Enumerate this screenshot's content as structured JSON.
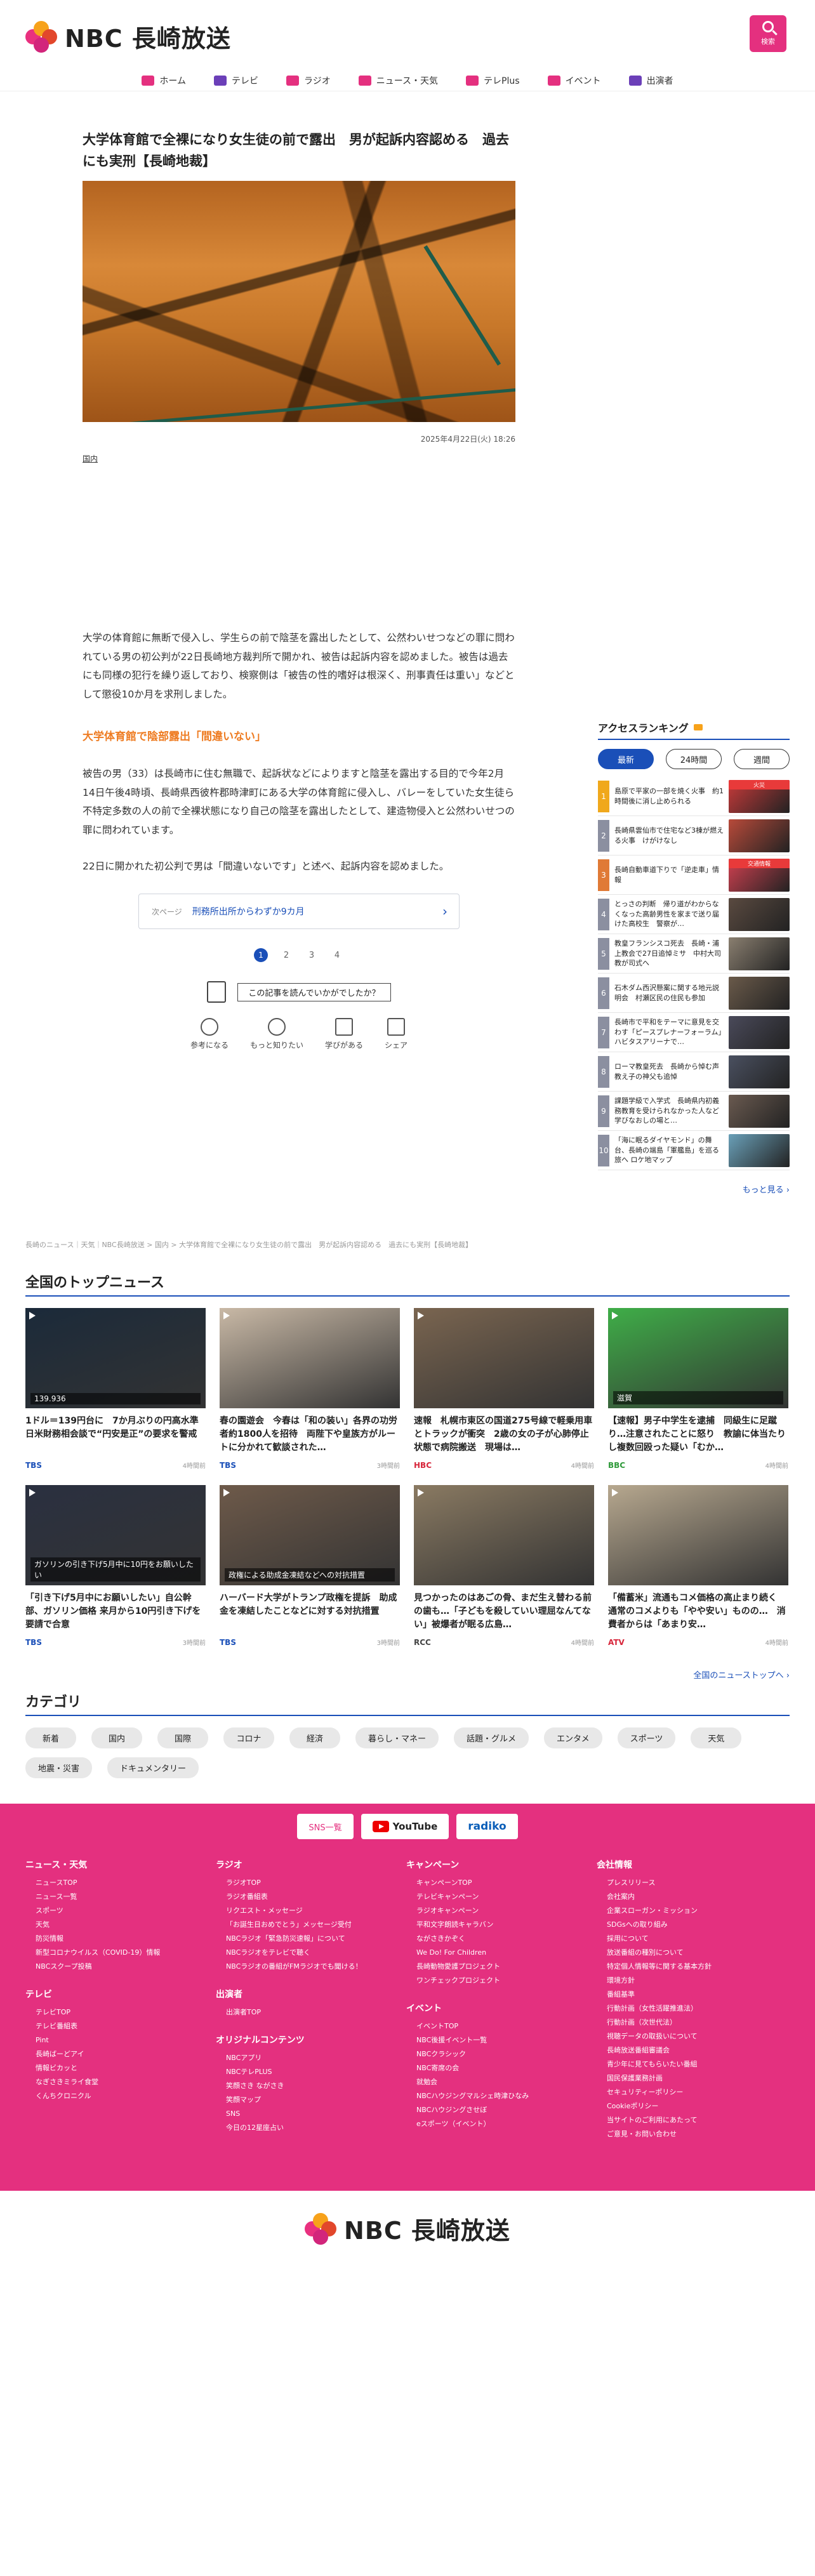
{
  "header": {
    "logo_text": "NBC 長崎放送",
    "search_label": "検索"
  },
  "nav": [
    {
      "label": "ホーム",
      "icon": "home-icon",
      "color": "#e4307f"
    },
    {
      "label": "テレビ",
      "icon": "tv-icon",
      "color": "#6b3fb8"
    },
    {
      "label": "ラジオ",
      "icon": "radio-icon",
      "color": "#e4307f"
    },
    {
      "label": "ニュース・天気",
      "icon": "news-icon",
      "color": "#e4307f"
    },
    {
      "label": "テレPlus",
      "icon": "play-icon",
      "color": "#e4307f"
    },
    {
      "label": "イベント",
      "icon": "calendar-icon",
      "color": "#e4307f"
    },
    {
      "label": "出演者",
      "icon": "people-icon",
      "color": "#6b3fb8"
    }
  ],
  "article": {
    "title": "大学体育館で全裸になり女生徒の前で露出　男が起訴内容認める　過去にも実刑【長崎地裁】",
    "date": "2025年4月22日(火) 18:26",
    "genre": "国内",
    "para1": "大学の体育館に無断で侵入し、学生らの前で陰茎を露出したとして、公然わいせつなどの罪に問われている男の初公判が22日長崎地方裁判所で開かれ、被告は起訴内容を認めました。被告は過去にも同様の犯行を繰り返しており、検察側は「被告の性的嗜好は根深く、刑事責任は重い」などとして懲役10か月を求刑しました。",
    "subhead": "大学体育館で陰部露出「間違いない」",
    "para2": "被告の男（33）は長崎市に住む無職で、起訴状などによりますと陰茎を露出する目的で今年2月14日午後4時頃、長崎県西彼杵郡時津町にある大学の体育館に侵入し、バレーをしていた女生徒ら不特定多数の人の前で全裸状態になり自己の陰茎を露出したとして、建造物侵入と公然わいせつの罪に問われています。",
    "para3": "22日に開かれた初公判で男は「間違いないです」と述べ、起訴内容を認めました。",
    "next_label": "次ページ",
    "next_title": "刑務所出所からわずか9カ月",
    "pages": [
      "1",
      "2",
      "3",
      "4"
    ],
    "feedback_question": "この記事を読んでいかがでしたか？",
    "reactions": [
      "参考になる",
      "もっと知りたい",
      "学びがある",
      "シェア"
    ]
  },
  "ranking": {
    "title": "アクセスランキング",
    "tabs": [
      "最新",
      "24時間",
      "週間"
    ],
    "items": [
      {
        "num": "1",
        "text": "島原で平家の一部を焼く火事　約1時間後に消し止められる",
        "color": "#f0a81c",
        "badge": "火災"
      },
      {
        "num": "2",
        "text": "長崎県雲仙市で住宅など3棟が燃える火事　けがけなし",
        "color": "#8b8fa0",
        "badge": ""
      },
      {
        "num": "3",
        "text": "長崎自動車道下りで「逆走車」情報",
        "color": "#e07a36",
        "badge": "交通情報"
      },
      {
        "num": "4",
        "text": "とっさの判断　帰り道がわからなくなった高齢男性を家まで送り届けた高校生　警察が…",
        "color": "#8b8fa0",
        "badge": ""
      },
      {
        "num": "5",
        "text": "教皇フランシスコ死去　長崎・浦上教会で27日追悼ミサ　中村大司教が司式へ",
        "color": "#8b8fa0",
        "badge": ""
      },
      {
        "num": "6",
        "text": "石木ダム西沢懸案に関する地元説明会　村瀬区民の住民も参加",
        "color": "#8b8fa0",
        "badge": ""
      },
      {
        "num": "7",
        "text": "長崎市で平和をテーマに意見を交わす「ピースプレナーフォーラム」ハビタスアリーナで…",
        "color": "#8b8fa0",
        "badge": ""
      },
      {
        "num": "8",
        "text": "ローマ教皇死去　長崎から悼む声　教え子の神父も追悼",
        "color": "#8b8fa0",
        "badge": ""
      },
      {
        "num": "9",
        "text": "課題学級で入学式　長崎県内初義務教育を受けられなかった人など学びなおしの場と…",
        "color": "#8b8fa0",
        "badge": ""
      },
      {
        "num": "10",
        "text": "「海に眠るダイヤモンド」の舞台、長崎の端島「軍艦島」を巡る旅へ ロケ地マップ",
        "color": "#8b8fa0",
        "badge": ""
      }
    ],
    "more": "もっと見る ›"
  },
  "breadcrumb": "長崎のニュース｜天気｜NBC長崎放送 > 国内 > 大学体育館で全裸になり女生徒の前で露出　男が起訴内容認める　過去にも実刑【長崎地裁】",
  "top_news": {
    "title": "全国のトップニュース",
    "items": [
      {
        "title": "1ドル＝139円台に　7か月ぶりの円高水準　日米財務相会談で“円安是正”の要求を警戒",
        "src": "TBS",
        "time": "4時間前",
        "cap": "139.936",
        "color": "#1b2a3a",
        "srccolor": "#1a4fb8"
      },
      {
        "title": "春の園遊会　今春は「和の装い」各界の功労者約1800人を招待　両陛下や皇族方がルートに分かれて歓談された…",
        "src": "TBS",
        "time": "3時間前",
        "cap": "",
        "color": "#c9b9a6",
        "srccolor": "#1a4fb8"
      },
      {
        "title": "速報　札幌市東区の国道275号線で軽乗用車とトラックが衝突　2歳の女の子が心肺停止状態で病院搬送　現場は…",
        "src": "HBC",
        "time": "4時間前",
        "cap": "",
        "color": "#7a6550",
        "srccolor": "#d7253a"
      },
      {
        "title": "【速報】男子中学生を逮捕　同級生に足蹴り…注意されたことに怒り　教諭に体当たりし複数回殴った疑い「むか…",
        "src": "BBC",
        "time": "4時間前",
        "cap": "滋賀",
        "color": "#3fae48",
        "srccolor": "#2f9a3a"
      },
      {
        "title": "「引き下げ5月中にお願いしたい」自公幹部、ガソリン価格 来月から10円引き下げを要請で合意",
        "src": "TBS",
        "time": "3時間前",
        "cap": "ガソリンの引き下げ5月中に10円をお願いしたい",
        "color": "#2a3040",
        "srccolor": "#1a4fb8"
      },
      {
        "title": "ハーバード大学がトランプ政権を提訴　助成金を凍結したことなどに対する対抗措置",
        "src": "TBS",
        "time": "3時間前",
        "cap": "政権による助成金凍結などへの対抗措置",
        "color": "#6e5a4a",
        "srccolor": "#1a4fb8"
      },
      {
        "title": "見つかったのはあごの骨、まだ生え替わる前の歯も…「子どもを殺していい理屈なんてない」被爆者が眠る広島…",
        "src": "RCC",
        "time": "4時間前",
        "cap": "",
        "color": "#8a7a62",
        "srccolor": "#444444"
      },
      {
        "title": "「備蓄米」流通もコメ価格の高止まり続く　通常のコメよりも「やや安い」ものの…　消費者からは「あまり安…",
        "src": "ATV",
        "time": "4時間前",
        "cap": "",
        "color": "#b7a88f",
        "srccolor": "#d7253a"
      }
    ],
    "all_link": "全国のニューストップへ ›"
  },
  "categories": {
    "title": "カテゴリ",
    "items": [
      "新着",
      "国内",
      "国際",
      "コロナ",
      "経済",
      "暮らし・マネー",
      "話題・グルメ",
      "エンタメ",
      "スポーツ",
      "天気",
      "地震・災害",
      "ドキュメンタリー"
    ]
  },
  "footer": {
    "buttons": [
      "SNS一覧",
      "YouTube",
      "radiko"
    ],
    "cols": [
      [
        {
          "title": "ニュース・天気",
          "items": [
            "ニュースTOP",
            "ニュース一覧",
            "スポーツ",
            "天気",
            "防災情報",
            "新型コロナウイルス（COVID-19）情報",
            "NBCスクープ投稿"
          ]
        },
        {
          "title": "テレビ",
          "items": [
            "テレビTOP",
            "テレビ番組表",
            "Pint",
            "長崎ばーどアイ",
            "情報ビカッと",
            "なぎさきミライ食堂",
            "くんちクロニクル"
          ]
        }
      ],
      [
        {
          "title": "ラジオ",
          "items": [
            "ラジオTOP",
            "ラジオ番組表",
            "リクエスト・メッセージ",
            "「お誕生日おめでとう」メッセージ受付",
            "NBCラジオ「緊急防災速報」について",
            "NBCラジオをテレビで聴く",
            "NBCラジオの番組がFMラジオでも聞ける！"
          ]
        },
        {
          "title": "出演者",
          "items": [
            "出演者TOP"
          ]
        },
        {
          "title": "オリジナルコンテンツ",
          "items": [
            "NBCアプリ",
            "NBCテレPLUS",
            "笑顔さき ながさき",
            "笑顔マップ",
            "SNS",
            "今日の12星座占い"
          ]
        }
      ],
      [
        {
          "title": "キャンペーン",
          "items": [
            "キャンペーンTOP",
            "テレビキャンペーン",
            "ラジオキャンペーン",
            "平和文字朗読キャラバン",
            "ながさきかぞく",
            "We Do! For Children",
            "長崎動物愛護プロジェクト",
            "ワンチェックプロジェクト"
          ]
        },
        {
          "title": "イベント",
          "items": [
            "イベントTOP",
            "NBC後援イベント一覧",
            "NBCクラシック",
            "NBC寄席の会",
            "就勉会",
            "NBCハウジングマルシェ時津ひなみ",
            "NBCハウジングさせぼ",
            "eスポーツ（イベント）"
          ]
        }
      ],
      [
        {
          "title": "会社情報",
          "items": [
            "プレスリリース",
            "会社案内",
            "企業スローガン・ミッション",
            "SDGsへの取り組み",
            "採用について",
            "放送番組の種別について",
            "特定個人情報等に関する基本方針",
            "環境方針",
            "番組基準",
            "行動計画（女性活躍推進法）",
            "行動計画（次世代法）",
            "視聴データの取扱いについて",
            "長崎放送番組審議会",
            "青少年に見てもらいたい番組",
            "国民保護業務計画",
            "セキュリティーポリシー",
            "Cookieポリシー",
            "当サイトのご利用にあたって",
            "ご意見・お問い合わせ"
          ]
        }
      ]
    ]
  },
  "bottom_logo": "NBC 長崎放送"
}
